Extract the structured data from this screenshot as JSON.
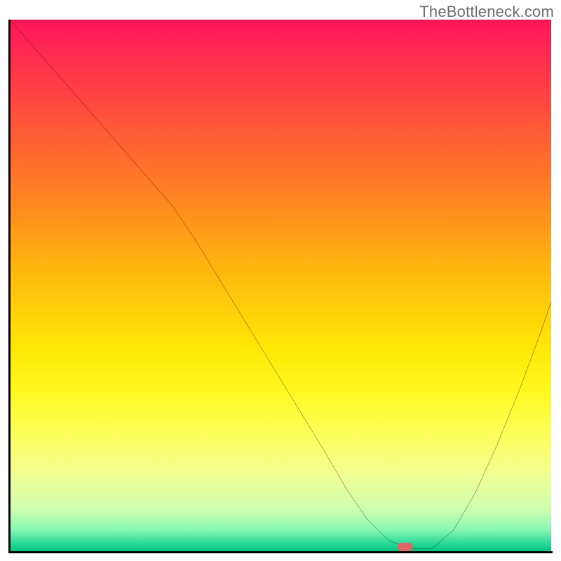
{
  "watermark": "TheBottleneck.com",
  "chart_data": {
    "type": "line",
    "title": "",
    "xlabel": "",
    "ylabel": "",
    "grid": false,
    "legend": false,
    "xlim": [
      0,
      100
    ],
    "ylim": [
      0,
      100
    ],
    "background_gradient_meaning": "red = high bottleneck, green = low bottleneck",
    "series": [
      {
        "name": "bottleneck-curve",
        "color": "#000000",
        "x": [
          0,
          6,
          12,
          18,
          24,
          30,
          34,
          40,
          46,
          52,
          58,
          62,
          66,
          70,
          74,
          78,
          82,
          86,
          90,
          94,
          98,
          100
        ],
        "y": [
          100,
          93,
          86,
          79,
          72,
          65,
          59,
          49,
          39,
          29,
          19,
          12,
          6,
          2,
          0.5,
          0.5,
          4,
          11,
          20,
          30,
          41,
          47
        ]
      }
    ],
    "annotations": [
      {
        "name": "optimal-point-marker",
        "type": "pill",
        "color": "#e0666a",
        "x": 73,
        "y": 0.8
      }
    ]
  }
}
